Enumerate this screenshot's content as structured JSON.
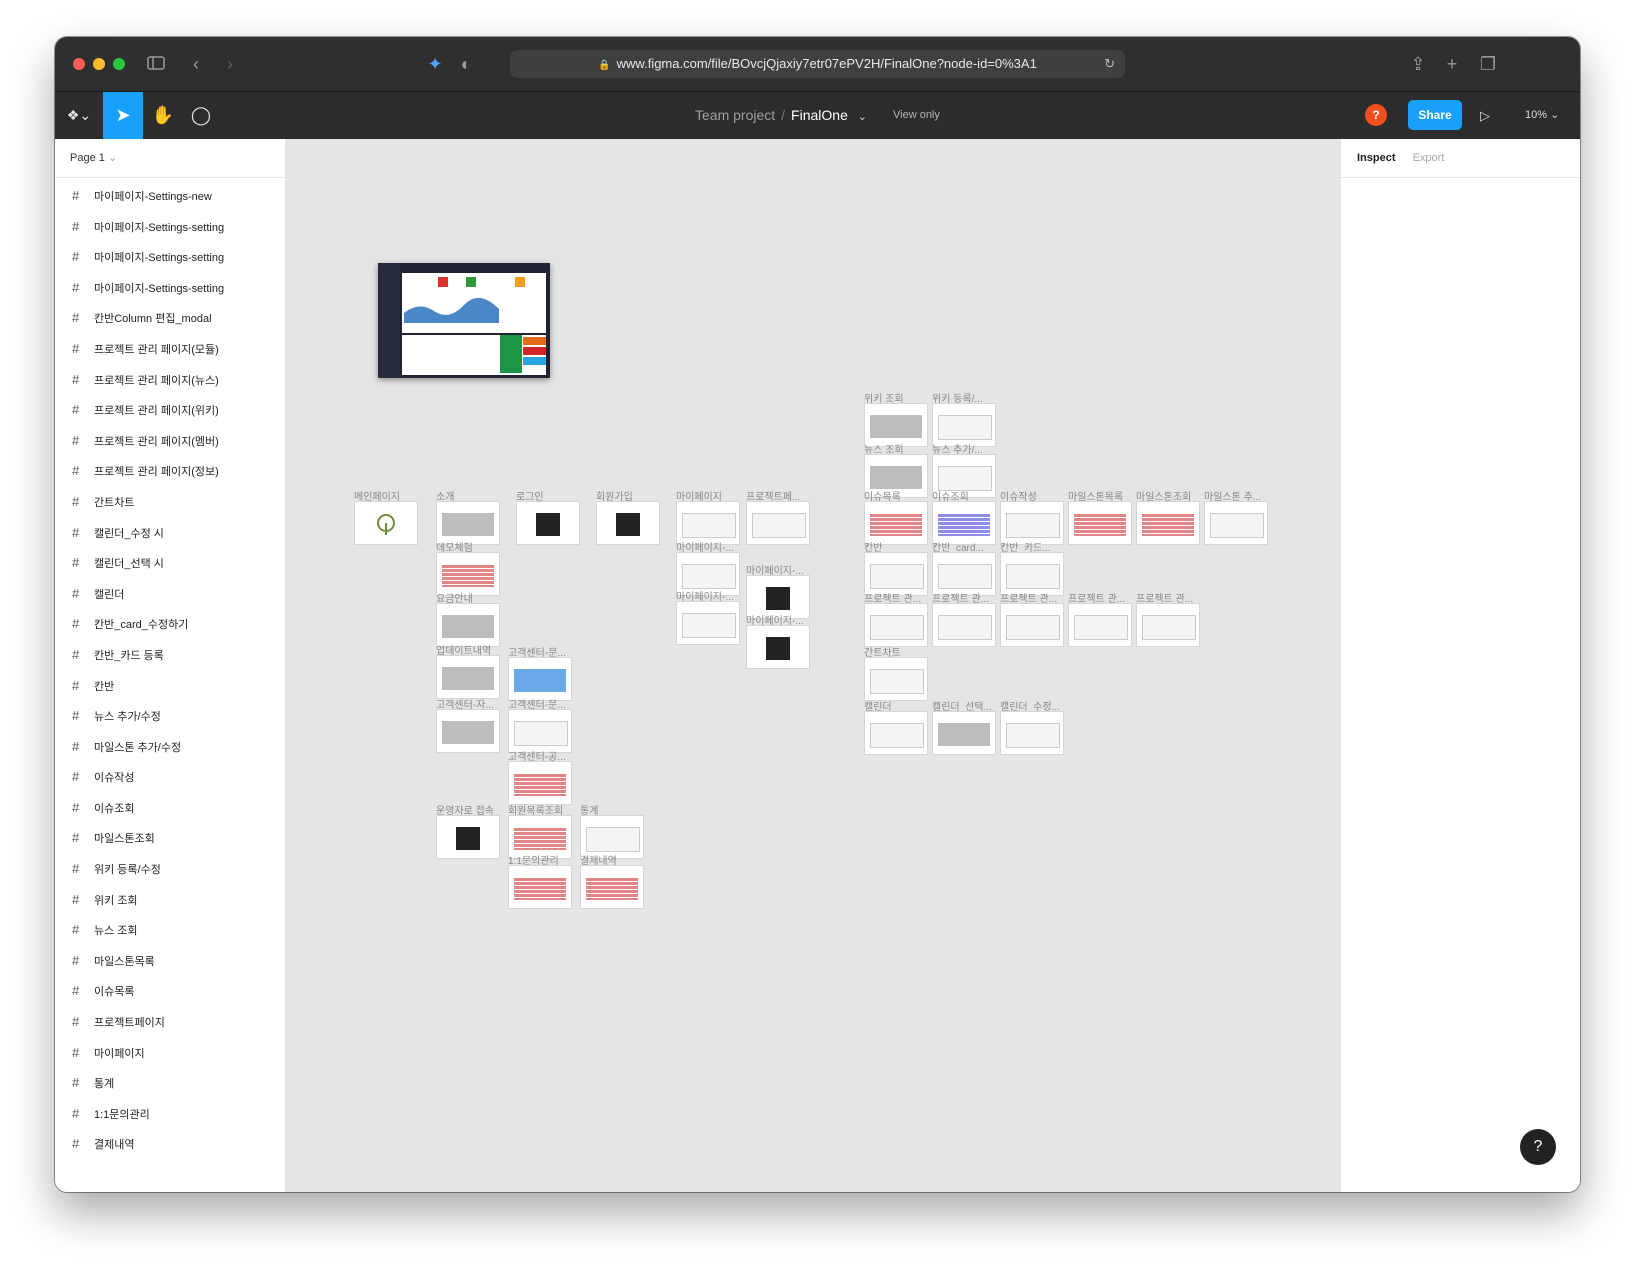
{
  "browser": {
    "url": "www.figma.com/file/BOvcjQjaxiy7etr07ePV2H/FinalOne?node-id=0%3A1",
    "colors": {
      "close": "#ff5f57",
      "minimize": "#febc2e",
      "zoom": "#28c840"
    }
  },
  "toolbar": {
    "project": "Team project",
    "separator": "/",
    "file": "FinalOne",
    "view_mode": "View only",
    "avatar": "?",
    "share": "Share",
    "zoom": "10%",
    "accent": "#18a0fb"
  },
  "left_panel": {
    "page": "Page 1",
    "layers": [
      "마이페이지-Settings-new",
      "마이페이지-Settings-setting",
      "마이페이지-Settings-setting",
      "마이페이지-Settings-setting",
      "칸반Column 편집_modal",
      "프로젝트 관리 페이지(모듈)",
      "프로젝트 관리 페이지(뉴스)",
      "프로젝트 관리 페이지(위키)",
      "프로젝트 관리 페이지(멤버)",
      "프로젝트 관리 페이지(정보)",
      "간트차트",
      "캘린더_수정 시",
      "캘린더_선택 시",
      "캘린더",
      "칸반_card_수정하기",
      "칸반_카드 등록",
      "칸반",
      "뉴스 추가/수정",
      "마일스톤 추가/수정",
      "이슈작성",
      "이슈조회",
      "마일스톤조회",
      "위키 등록/수정",
      "위키 조회",
      "뉴스 조회",
      "마일스톤목록",
      "이슈목록",
      "프로젝트페이지",
      "마이페이지",
      "통계",
      "1:1문의관리",
      "결제내역"
    ]
  },
  "right_panel": {
    "tabs": [
      "Inspect",
      "Export"
    ],
    "help": "?"
  },
  "canvas_labels": {
    "wiki_view": "위키 조회",
    "wiki_reg": "위키 등록/...",
    "news_view": "뉴스 조회",
    "news_add": "뉴스 추가/...",
    "main": "메인페이지",
    "intro": "소개",
    "login": "로그인",
    "signup": "회원가입",
    "mypage": "마이페이지",
    "project": "프로젝트페...",
    "issue_list": "이슈목록",
    "issue_view": "이슈조회",
    "issue_write": "이슈작성",
    "ms_list": "마일스톤목록",
    "ms_view": "마일스톤조회",
    "ms_add": "마일스톤 추...",
    "demo": "데모체험",
    "pricing": "요금안내",
    "updates": "업데이트내역",
    "cs1": "고객센터-문...",
    "cs2": "고객센터-자...",
    "cs3": "고객센터-문...",
    "cs4": "고객센터-공...",
    "my2": "마이페이지-...",
    "my3": "마이페이지-...",
    "my4": "마이페이지-...",
    "my5": "마이페이지-...",
    "kanban": "칸반",
    "kanban_card": "칸반_card...",
    "kanban_card2": "칸반_카드...",
    "pm1": "프로젝트 관...",
    "pm2": "프로젝트 관...",
    "pm3": "프로젝트 관...",
    "pm4": "프로젝트 관...",
    "pm5": "프로젝트 관...",
    "gantt": "간트차트",
    "calendar": "캘린더",
    "cal_select": "캘린더_선택...",
    "cal_edit": "캘린더_수정...",
    "admin": "운영자로 접속",
    "members": "회원목록조회",
    "stats": "통계",
    "inquiry": "1:1문의관리",
    "payments": "결제내역"
  }
}
